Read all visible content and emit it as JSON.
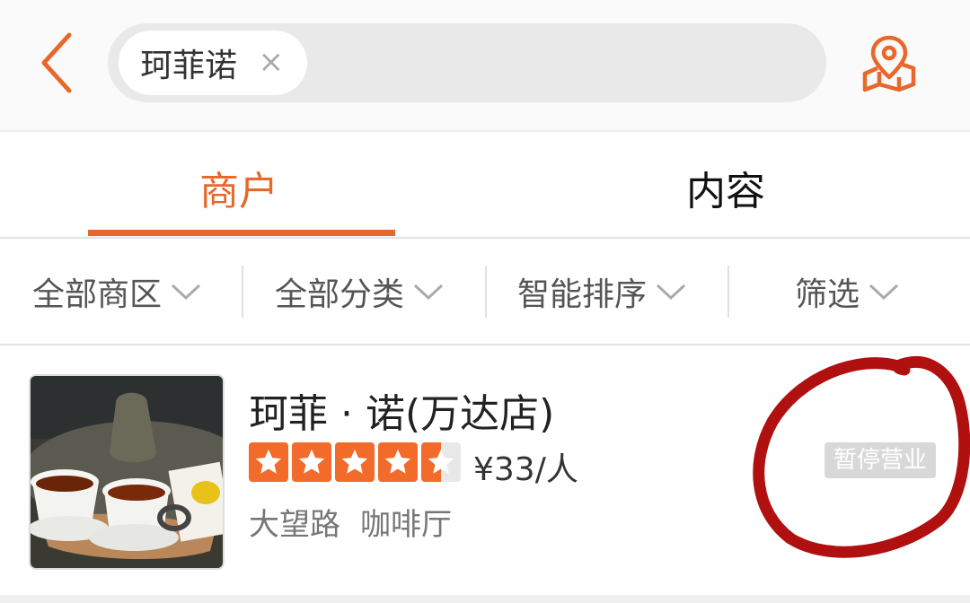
{
  "header": {
    "search_chip": "珂菲诺",
    "chip_close": "×"
  },
  "tabs": [
    {
      "label": "商户",
      "active": true
    },
    {
      "label": "内容",
      "active": false
    }
  ],
  "filters": [
    {
      "label": "全部商区"
    },
    {
      "label": "全部分类"
    },
    {
      "label": "智能排序"
    },
    {
      "label": "筛选"
    }
  ],
  "results": [
    {
      "name": "珂菲 · 诺(万达店)",
      "rating": 4.5,
      "price": "¥33/人",
      "area": "大望路",
      "category": "咖啡厅",
      "status": "暂停营业"
    }
  ],
  "colors": {
    "accent": "#e8672a",
    "annotation": "#b01010"
  },
  "icons": {
    "back": "chevron-left-icon",
    "map": "map-pin-icon",
    "dropdown": "chevron-down-icon",
    "star": "star-icon"
  }
}
